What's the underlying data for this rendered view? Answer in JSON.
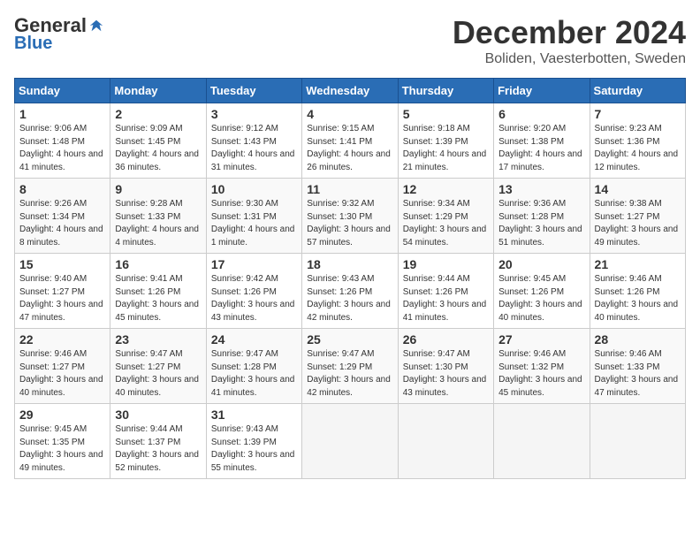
{
  "header": {
    "logo_general": "General",
    "logo_blue": "Blue",
    "month": "December 2024",
    "location": "Boliden, Vaesterbotten, Sweden"
  },
  "days_of_week": [
    "Sunday",
    "Monday",
    "Tuesday",
    "Wednesday",
    "Thursday",
    "Friday",
    "Saturday"
  ],
  "weeks": [
    [
      {
        "day": 1,
        "sunrise": "9:06 AM",
        "sunset": "1:48 PM",
        "daylight": "4 hours and 41 minutes"
      },
      {
        "day": 2,
        "sunrise": "9:09 AM",
        "sunset": "1:45 PM",
        "daylight": "4 hours and 36 minutes"
      },
      {
        "day": 3,
        "sunrise": "9:12 AM",
        "sunset": "1:43 PM",
        "daylight": "4 hours and 31 minutes"
      },
      {
        "day": 4,
        "sunrise": "9:15 AM",
        "sunset": "1:41 PM",
        "daylight": "4 hours and 26 minutes"
      },
      {
        "day": 5,
        "sunrise": "9:18 AM",
        "sunset": "1:39 PM",
        "daylight": "4 hours and 21 minutes"
      },
      {
        "day": 6,
        "sunrise": "9:20 AM",
        "sunset": "1:38 PM",
        "daylight": "4 hours and 17 minutes"
      },
      {
        "day": 7,
        "sunrise": "9:23 AM",
        "sunset": "1:36 PM",
        "daylight": "4 hours and 12 minutes"
      }
    ],
    [
      {
        "day": 8,
        "sunrise": "9:26 AM",
        "sunset": "1:34 PM",
        "daylight": "4 hours and 8 minutes"
      },
      {
        "day": 9,
        "sunrise": "9:28 AM",
        "sunset": "1:33 PM",
        "daylight": "4 hours and 4 minutes"
      },
      {
        "day": 10,
        "sunrise": "9:30 AM",
        "sunset": "1:31 PM",
        "daylight": "4 hours and 1 minute"
      },
      {
        "day": 11,
        "sunrise": "9:32 AM",
        "sunset": "1:30 PM",
        "daylight": "3 hours and 57 minutes"
      },
      {
        "day": 12,
        "sunrise": "9:34 AM",
        "sunset": "1:29 PM",
        "daylight": "3 hours and 54 minutes"
      },
      {
        "day": 13,
        "sunrise": "9:36 AM",
        "sunset": "1:28 PM",
        "daylight": "3 hours and 51 minutes"
      },
      {
        "day": 14,
        "sunrise": "9:38 AM",
        "sunset": "1:27 PM",
        "daylight": "3 hours and 49 minutes"
      }
    ],
    [
      {
        "day": 15,
        "sunrise": "9:40 AM",
        "sunset": "1:27 PM",
        "daylight": "3 hours and 47 minutes"
      },
      {
        "day": 16,
        "sunrise": "9:41 AM",
        "sunset": "1:26 PM",
        "daylight": "3 hours and 45 minutes"
      },
      {
        "day": 17,
        "sunrise": "9:42 AM",
        "sunset": "1:26 PM",
        "daylight": "3 hours and 43 minutes"
      },
      {
        "day": 18,
        "sunrise": "9:43 AM",
        "sunset": "1:26 PM",
        "daylight": "3 hours and 42 minutes"
      },
      {
        "day": 19,
        "sunrise": "9:44 AM",
        "sunset": "1:26 PM",
        "daylight": "3 hours and 41 minutes"
      },
      {
        "day": 20,
        "sunrise": "9:45 AM",
        "sunset": "1:26 PM",
        "daylight": "3 hours and 40 minutes"
      },
      {
        "day": 21,
        "sunrise": "9:46 AM",
        "sunset": "1:26 PM",
        "daylight": "3 hours and 40 minutes"
      }
    ],
    [
      {
        "day": 22,
        "sunrise": "9:46 AM",
        "sunset": "1:27 PM",
        "daylight": "3 hours and 40 minutes"
      },
      {
        "day": 23,
        "sunrise": "9:47 AM",
        "sunset": "1:27 PM",
        "daylight": "3 hours and 40 minutes"
      },
      {
        "day": 24,
        "sunrise": "9:47 AM",
        "sunset": "1:28 PM",
        "daylight": "3 hours and 41 minutes"
      },
      {
        "day": 25,
        "sunrise": "9:47 AM",
        "sunset": "1:29 PM",
        "daylight": "3 hours and 42 minutes"
      },
      {
        "day": 26,
        "sunrise": "9:47 AM",
        "sunset": "1:30 PM",
        "daylight": "3 hours and 43 minutes"
      },
      {
        "day": 27,
        "sunrise": "9:46 AM",
        "sunset": "1:32 PM",
        "daylight": "3 hours and 45 minutes"
      },
      {
        "day": 28,
        "sunrise": "9:46 AM",
        "sunset": "1:33 PM",
        "daylight": "3 hours and 47 minutes"
      }
    ],
    [
      {
        "day": 29,
        "sunrise": "9:45 AM",
        "sunset": "1:35 PM",
        "daylight": "3 hours and 49 minutes"
      },
      {
        "day": 30,
        "sunrise": "9:44 AM",
        "sunset": "1:37 PM",
        "daylight": "3 hours and 52 minutes"
      },
      {
        "day": 31,
        "sunrise": "9:43 AM",
        "sunset": "1:39 PM",
        "daylight": "3 hours and 55 minutes"
      },
      null,
      null,
      null,
      null
    ]
  ]
}
